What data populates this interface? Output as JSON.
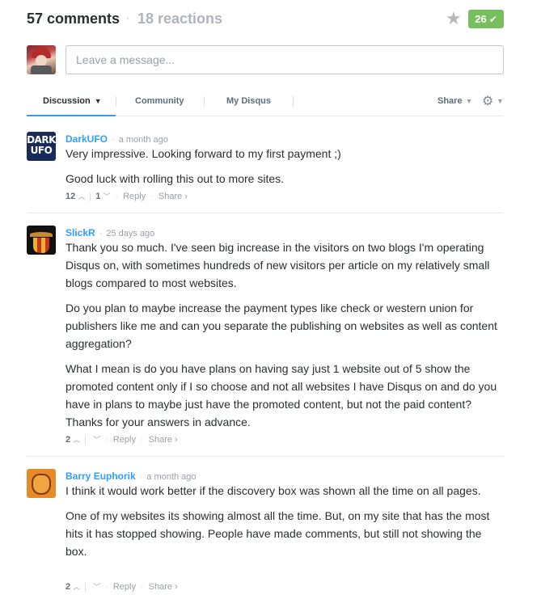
{
  "header": {
    "comment_count": "57 comments",
    "reactions": "18 reactions",
    "recommend_count": "26",
    "recommend_check": "✔",
    "star_icon": "star-icon"
  },
  "compose": {
    "placeholder": "Leave a message..."
  },
  "tabs": {
    "items": [
      {
        "label": "Discussion"
      },
      {
        "label": "Community"
      },
      {
        "label": "My Disqus"
      }
    ],
    "share_label": "Share"
  },
  "actions": {
    "reply": "Reply",
    "share": "Share ›"
  },
  "posts": [
    {
      "author": "DarkUFO",
      "time": "a month ago",
      "avatar_text_1": "DARK",
      "avatar_text_2": "UFO",
      "paragraphs": [
        "Very impressive. Looking forward to my first payment ;)",
        "Good luck with rolling this out to more sites."
      ],
      "upvotes": "12",
      "downvotes": "1"
    },
    {
      "author": "SlickR",
      "time": "25 days ago",
      "paragraphs": [
        "Thank you so much. I've seen big increase in the visitors on two blogs I'm operating Disqus on, with sometimes hundreds of new visitors per article on my relatively small blogs compared to most websites.",
        "Do you plan to maybe increase the payment types like check or western union for publishers like me and can you separate the publishing on websites as well as content aggregation?",
        "What I mean is do you have plans on having say just 1 website out of 5 show the promoted content only if I so choose and not all websites I have Disqus on and do you have in plans to maybe just have the promoted content, but not the paid content? Thanks for your answers in advance."
      ],
      "upvotes": "2",
      "downvotes": ""
    },
    {
      "author": "Barry Euphorik",
      "time": "a month ago",
      "paragraphs": [
        "I think it would work better if the discovery box was shown all the time on all pages.",
        "One of my websites its showing almost all the time. But, on my site that has the most hits it has stopped showing. People have made comments, but still not showing the box."
      ],
      "upvotes": "2",
      "downvotes": ""
    }
  ]
}
